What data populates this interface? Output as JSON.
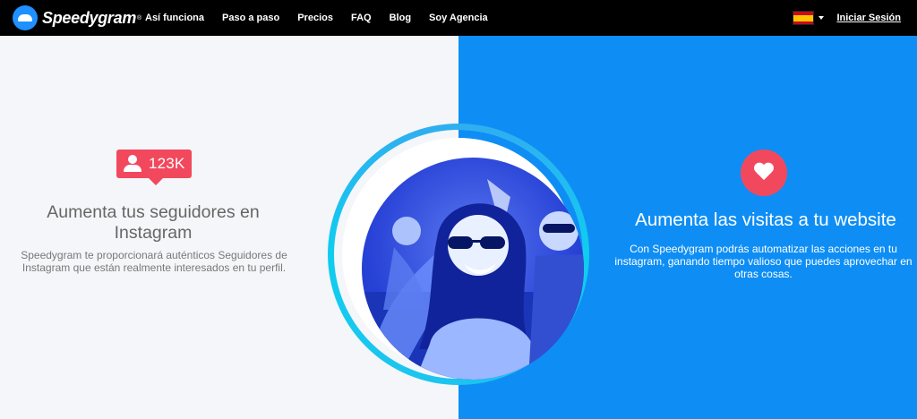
{
  "nav": {
    "brand": "Speedygram",
    "brand_mark": "®",
    "items": [
      "Así funciona",
      "Paso a paso",
      "Precios",
      "FAQ",
      "Blog",
      "Soy Agencia"
    ],
    "login": "Iniciar Sesión",
    "language_icon": "spain-flag-icon"
  },
  "left": {
    "badge_icon": "user-icon",
    "badge_count": "123K",
    "title": "Aumenta tus seguidores en Instagram",
    "text": "Speedygram te proporcionará auténticos Seguidores de Instagram que están realmente interesados en tu perfil."
  },
  "right": {
    "icon": "heart-icon",
    "title": "Aumenta las visitas a tu website",
    "text": "Con Speedygram podrás automatizar las acciones en tu instagram, ganando tiempo valioso que puedes aprovechar en otras cosas."
  },
  "colors": {
    "left_bg": "#f4f6f9",
    "right_bg": "#0e8ef5",
    "accent_red": "#f2485d",
    "ring": "#2bb9ef"
  }
}
